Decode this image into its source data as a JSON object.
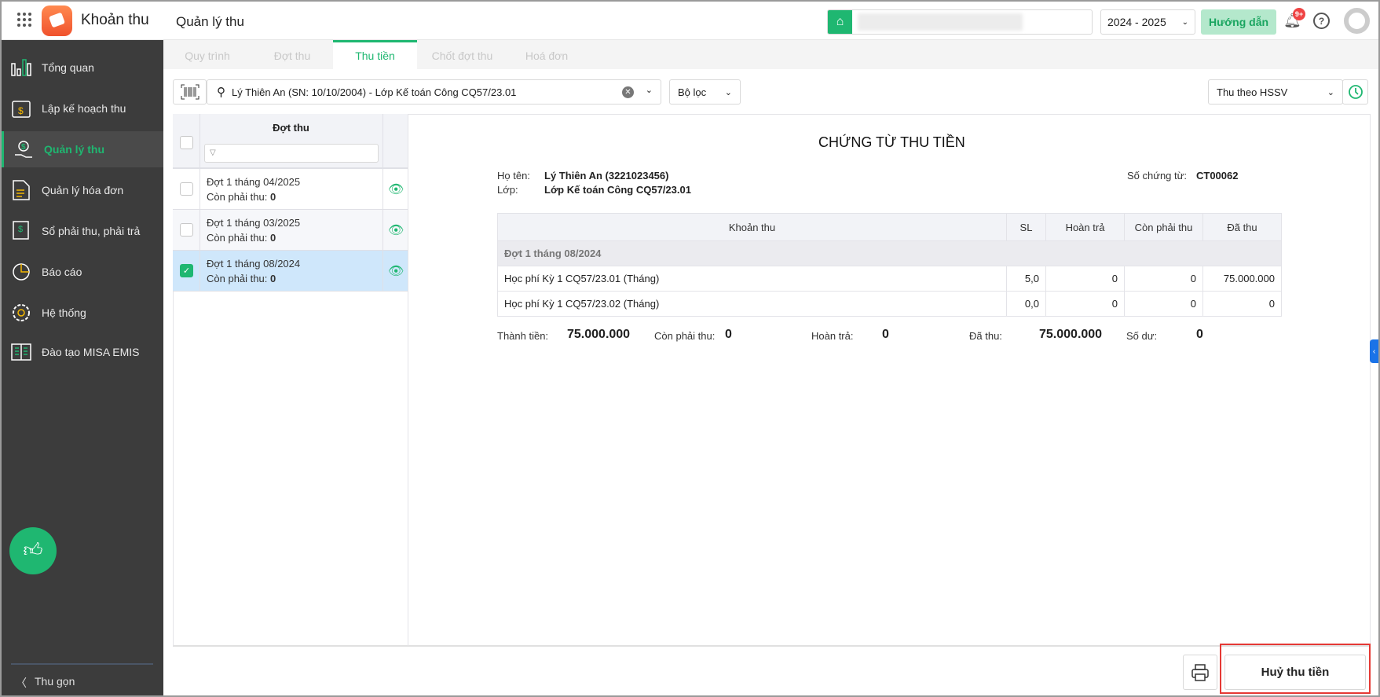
{
  "header": {
    "app_name": "Khoản thu",
    "page_title": "Quản lý thu",
    "school_year": "2024 - 2025",
    "guide_label": "Hướng dẫn",
    "notif_badge": "9+"
  },
  "sidebar": {
    "items": [
      {
        "label": "Tổng quan"
      },
      {
        "label": "Lập kế hoạch thu"
      },
      {
        "label": "Quản lý thu"
      },
      {
        "label": "Quản lý hóa đơn"
      },
      {
        "label": "Sổ phải thu, phải trả"
      },
      {
        "label": "Báo cáo"
      },
      {
        "label": "Hệ thống"
      },
      {
        "label": "Đào tạo MISA EMIS"
      }
    ],
    "collapse_label": "Thu gọn"
  },
  "tabs": [
    {
      "label": "Quy trình"
    },
    {
      "label": "Đợt thu"
    },
    {
      "label": "Thu tiền"
    },
    {
      "label": "Chốt đợt thu"
    },
    {
      "label": "Hoá đơn"
    }
  ],
  "toolbar": {
    "search_value": "Lý Thiên An (SN: 10/10/2004) - Lớp Kế toán Công CQ57/23.01",
    "filter_label": "Bộ lọc",
    "mode_select": "Thu theo HSSV"
  },
  "batch_list": {
    "header": "Đợt thu",
    "remaining_label": "Còn phải thu:",
    "rows": [
      {
        "name": "Đợt 1 tháng 04/2025",
        "remaining": "0",
        "checked": false
      },
      {
        "name": "Đợt 1 tháng 03/2025",
        "remaining": "0",
        "checked": false
      },
      {
        "name": "Đợt 1 tháng 08/2024",
        "remaining": "0",
        "checked": true
      }
    ]
  },
  "document": {
    "title": "CHỨNG TỪ THU TIỀN",
    "name_label": "Họ tên:",
    "name_value": "Lý Thiên An (3221023456)",
    "class_label": "Lớp:",
    "class_value": "Lớp Kế toán Công CQ57/23.01",
    "doc_no_label": "Số chứng từ:",
    "doc_no_value": "CT00062",
    "columns": [
      "Khoản thu",
      "SL",
      "Hoàn trả",
      "Còn phải thu",
      "Đã thu"
    ],
    "group": "Đợt 1 tháng 08/2024",
    "rows": [
      [
        "Học phí Kỳ 1 CQ57/23.01 (Tháng)",
        "5,0",
        "0",
        "0",
        "75.000.000"
      ],
      [
        "Học phí Kỳ 1 CQ57/23.02 (Tháng)",
        "0,0",
        "0",
        "0",
        "0"
      ]
    ],
    "summary": {
      "total_label": "Thành tiền:",
      "total": "75.000.000",
      "remaining_label": "Còn phải thu:",
      "remaining": "0",
      "refund_label": "Hoàn trả:",
      "refund": "0",
      "paid_label": "Đã thu:",
      "paid": "75.000.000",
      "balance_label": "Số dư:",
      "balance": "0"
    }
  },
  "footer": {
    "cancel_label": "Huỷ thu tiền"
  },
  "colors": {
    "accent": "#1fb771",
    "sidebar": "#3c3c3c",
    "selected_row": "#cfe7fb",
    "highlight": "#e53935"
  }
}
